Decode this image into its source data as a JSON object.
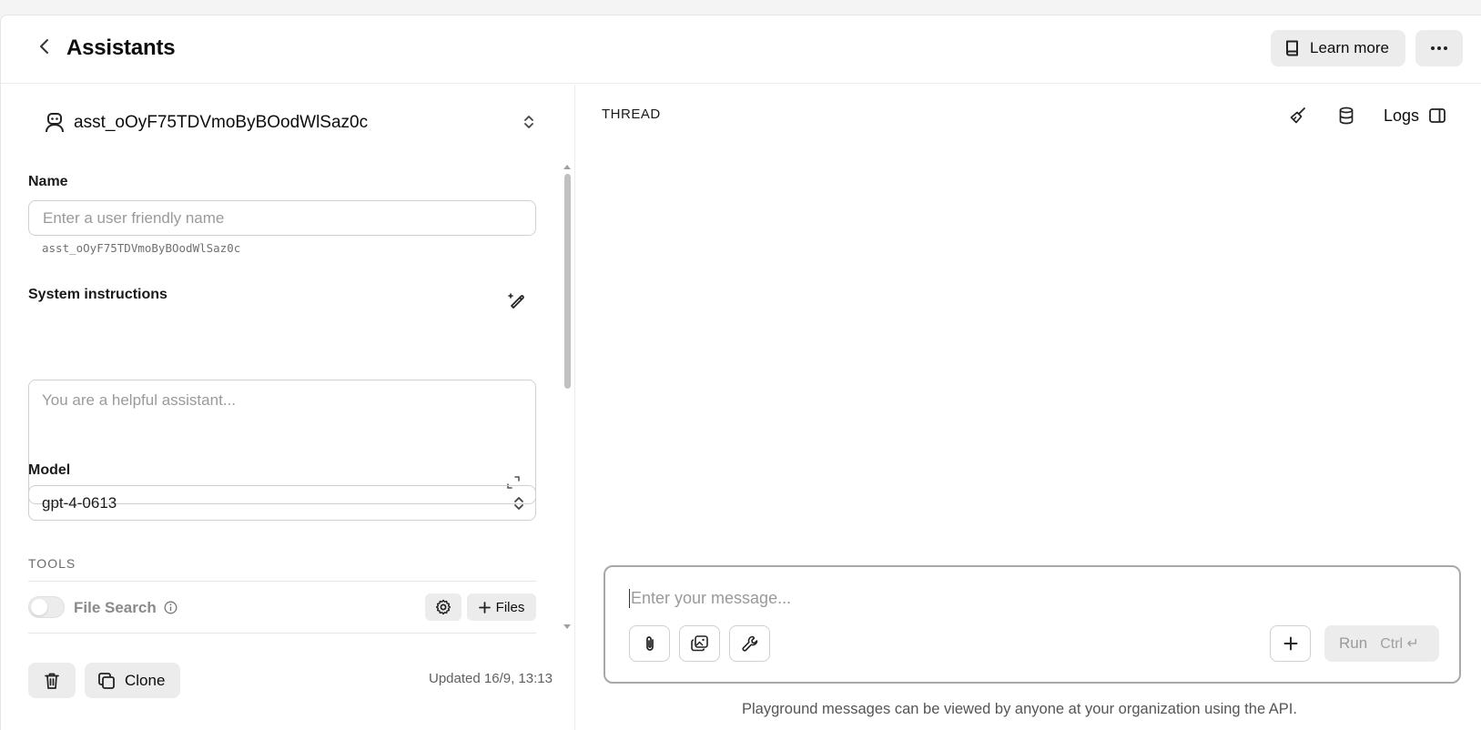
{
  "header": {
    "title": "Assistants",
    "learn_more_label": "Learn more"
  },
  "assistant": {
    "id": "asst_oOyF75TDVmoByBOodWlSaz0c",
    "name_label": "Name",
    "name_placeholder": "Enter a user friendly name",
    "id_caption": "asst_oOyF75TDVmoByBOodWlSaz0c",
    "instructions_label": "System instructions",
    "instructions_placeholder": "You are a helpful assistant...",
    "model_label": "Model",
    "model_value": "gpt-4-0613"
  },
  "tools": {
    "section_label": "TOOLS",
    "file_search_label": "File Search",
    "file_search_enabled": false,
    "files_button_label": "Files"
  },
  "footer_actions": {
    "clone_label": "Clone",
    "updated_text": "Updated 16/9, 13:13"
  },
  "thread": {
    "label": "THREAD",
    "logs_label": "Logs",
    "message_placeholder": "Enter your message...",
    "run_label": "Run",
    "run_shortcut": "Ctrl ↵",
    "footnote": "Playground messages can be viewed by anyone at your organization using the API."
  },
  "icons": {
    "back": "chevron-left-icon",
    "book": "book-icon",
    "more": "ellipsis-icon",
    "assistant": "robot-icon",
    "selector": "chevron-up-down-icon",
    "generate": "magic-pencil-icon",
    "expand": "expand-icon",
    "info": "info-icon",
    "gear": "gear-icon",
    "plus": "plus-icon",
    "trash": "trash-icon",
    "copy": "copy-icon",
    "broom": "broom-icon",
    "database": "database-icon",
    "sidebar": "sidebar-icon",
    "paperclip": "paperclip-icon",
    "images": "images-icon",
    "wrench": "wrench-icon"
  }
}
